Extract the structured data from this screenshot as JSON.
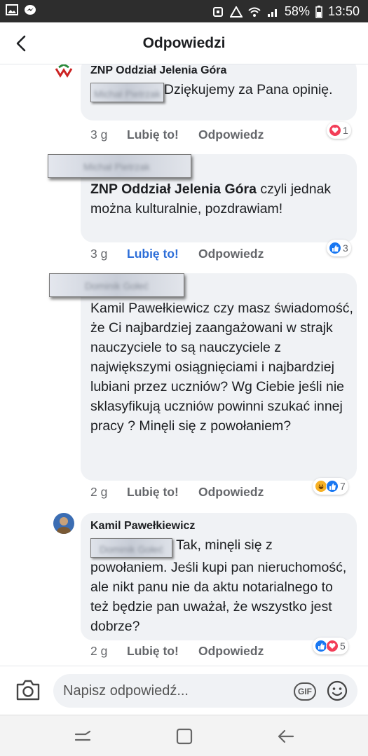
{
  "status_bar": {
    "battery": "58%",
    "time": "13:50"
  },
  "header": {
    "title": "Odpowiedzi"
  },
  "comments": [
    {
      "author": "ZNP Oddział Jelenia Góra",
      "tag": "Michał Pietrzak",
      "text": "Dziękujemy za Pana opinię.",
      "time": "3 g",
      "like": "Lubię to!",
      "reply": "Odpowiedz",
      "reaction_count": "1",
      "reaction_types": [
        "love"
      ]
    },
    {
      "author": "Michał Pietrzak",
      "mention": "ZNP Oddział Jelenia Góra",
      "text": " czyli jednak można kulturalnie, pozdrawiam!",
      "time": "3 g",
      "like": "Lubię to!",
      "liked": true,
      "reply": "Odpowiedz",
      "reaction_count": "3",
      "reaction_types": [
        "like"
      ]
    },
    {
      "author": "Dominik Gołeć",
      "text": "Kamil Pawełkiewicz czy masz świadomość, że Ci najbardziej zaangażowani w strajk nauczyciele to są nauczyciele z największymi osiągnięciami i najbardziej  lubiani przez uczniów?  Wg Ciebie jeśli nie sklasyfikują uczniów powinni szukać innej pracy ? Minęli się z powołaniem?",
      "time": "2 g",
      "like": "Lubię to!",
      "reply": "Odpowiedz",
      "reaction_count": "7",
      "reaction_types": [
        "haha",
        "like"
      ]
    },
    {
      "author": "Kamil Pawełkiewicz",
      "tag": "Dominik Gołeć",
      "text": " Tak, minęli się z powołaniem. Jeśli kupi pan nieruchomość, ale nikt panu  nie da aktu notarialnego to też będzie pan uważał, że wszystko jest dobrze?",
      "time": "2 g",
      "like": "Lubię to!",
      "reply": "Odpowiedz",
      "reaction_count": "5",
      "reaction_types": [
        "like",
        "love"
      ]
    }
  ],
  "composer": {
    "placeholder": "Napisz odpowiedź...",
    "gif_label": "GIF"
  },
  "colors": {
    "bubble": "#f0f2f5",
    "accent": "#2d6ed8",
    "love": "#f33e58",
    "status_bar": "#2d2d2d"
  },
  "icons": [
    "image-icon",
    "messenger-icon",
    "back-arrow-icon",
    "camera-icon",
    "emoji-icon",
    "recent-apps-icon",
    "home-icon",
    "nav-back-icon"
  ]
}
